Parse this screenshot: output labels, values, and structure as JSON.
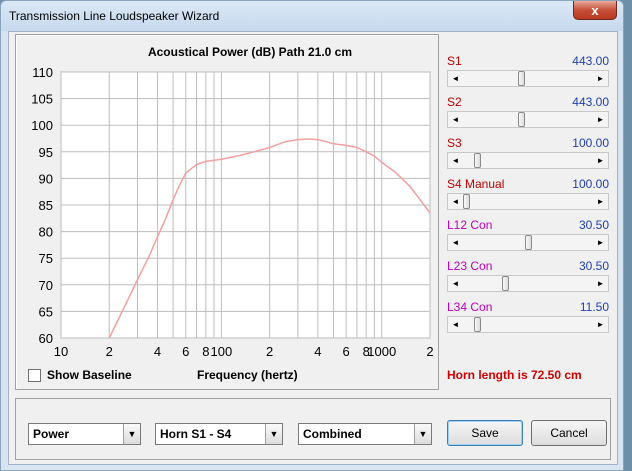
{
  "window": {
    "title": "Transmission Line Loudspeaker Wizard",
    "close_glyph": "x"
  },
  "chart_data": {
    "type": "line",
    "title": "Acoustical Power (dB)   Path 21.0 cm",
    "xlabel": "Frequency (hertz)",
    "ylabel": "",
    "xscale": "log",
    "xlim": [
      10,
      2000
    ],
    "ylim": [
      60,
      110
    ],
    "yticks": [
      "110",
      "105",
      "100",
      "95",
      "90",
      "85",
      "80",
      "75",
      "70",
      "65",
      "60"
    ],
    "xtick_labels": [
      {
        "x": 10,
        "label": "10"
      },
      {
        "x": 20,
        "label": "2"
      },
      {
        "x": 40,
        "label": "4"
      },
      {
        "x": 60,
        "label": "6"
      },
      {
        "x": 80,
        "label": "8"
      },
      {
        "x": 100,
        "label": "100"
      },
      {
        "x": 200,
        "label": "2"
      },
      {
        "x": 400,
        "label": "4"
      },
      {
        "x": 600,
        "label": "6"
      },
      {
        "x": 800,
        "label": "8"
      },
      {
        "x": 1000,
        "label": "1000"
      },
      {
        "x": 2000,
        "label": "2"
      }
    ],
    "grid": true,
    "line_color": "#f4a0a0",
    "series": [
      {
        "x": [
          20,
          25,
          30,
          35,
          40,
          45,
          50,
          55,
          60,
          70,
          80,
          100,
          130,
          160,
          200,
          250,
          300,
          350,
          400,
          450,
          500,
          600,
          700,
          800,
          900,
          1000,
          1200,
          1500,
          2000
        ],
        "y": [
          60,
          66,
          71,
          75,
          79,
          82.5,
          86,
          88.8,
          91,
          92.6,
          93.2,
          93.6,
          94.3,
          95,
          95.8,
          96.9,
          97.3,
          97.4,
          97.3,
          96.9,
          96.5,
          96.2,
          95.8,
          95,
          94.2,
          93,
          91.3,
          88.5,
          83.5
        ]
      }
    ]
  },
  "sliders": [
    {
      "name": "S1",
      "value": "443.00",
      "pos": 0.45,
      "con": false
    },
    {
      "name": "S2",
      "value": "443.00",
      "pos": 0.45,
      "con": false
    },
    {
      "name": "S3",
      "value": "100.00",
      "pos": 0.09,
      "con": false
    },
    {
      "name": "S4  Manual",
      "value": "100.00",
      "pos": 0.0,
      "con": false
    },
    {
      "name": "L12  Con",
      "value": "30.50",
      "pos": 0.5,
      "con": true
    },
    {
      "name": "L23  Con",
      "value": "30.50",
      "pos": 0.32,
      "con": true
    },
    {
      "name": "L34  Con",
      "value": "11.50",
      "pos": 0.09,
      "con": true
    }
  ],
  "baseline": {
    "label": "Show Baseline",
    "checked": false
  },
  "horn_length_text": "Horn length is 72.50 cm",
  "combos": {
    "mode": "Power",
    "section": "Horn S1 - S4",
    "combination": "Combined",
    "arrow_glyph": "▼"
  },
  "buttons": {
    "save": "Save",
    "cancel": "Cancel"
  },
  "scroll_arrows": {
    "left": "◄",
    "right": "►"
  }
}
